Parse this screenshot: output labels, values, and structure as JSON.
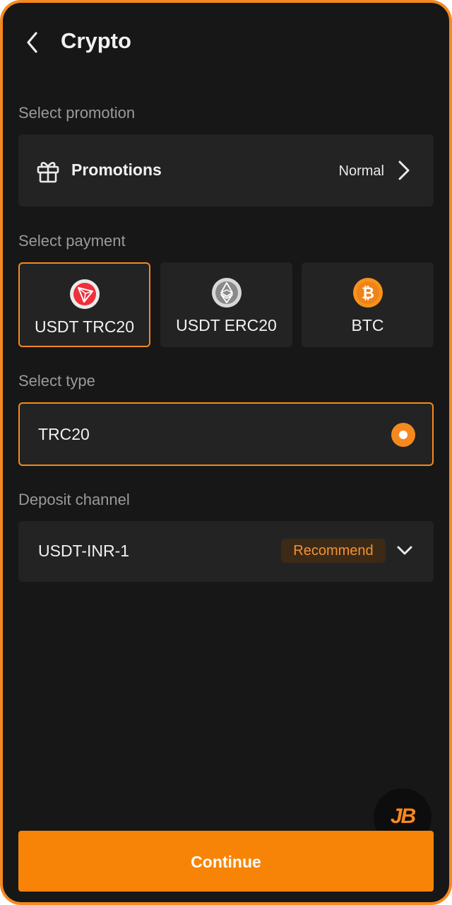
{
  "header": {
    "title": "Crypto"
  },
  "promotion_section": {
    "label": "Select promotion",
    "promotions_label": "Promotions",
    "value": "Normal"
  },
  "payment_section": {
    "label": "Select payment",
    "options": [
      {
        "label": "USDT TRC20",
        "icon": "tron-icon",
        "selected": true
      },
      {
        "label": "USDT ERC20",
        "icon": "ethereum-icon",
        "selected": false
      },
      {
        "label": "BTC",
        "icon": "bitcoin-icon",
        "selected": false
      }
    ]
  },
  "type_section": {
    "label": "Select type",
    "option": "TRC20",
    "selected": true
  },
  "channel_section": {
    "label": "Deposit channel",
    "value": "USDT-INR-1",
    "badge": "Recommend"
  },
  "floating_button": {
    "logo_text": "JB"
  },
  "continue_button": "Continue",
  "colors": {
    "accent": "#f5891f",
    "background": "#171717",
    "card": "#232323",
    "badge_bg": "#3c2a17",
    "muted_text": "#9a9a9a"
  }
}
